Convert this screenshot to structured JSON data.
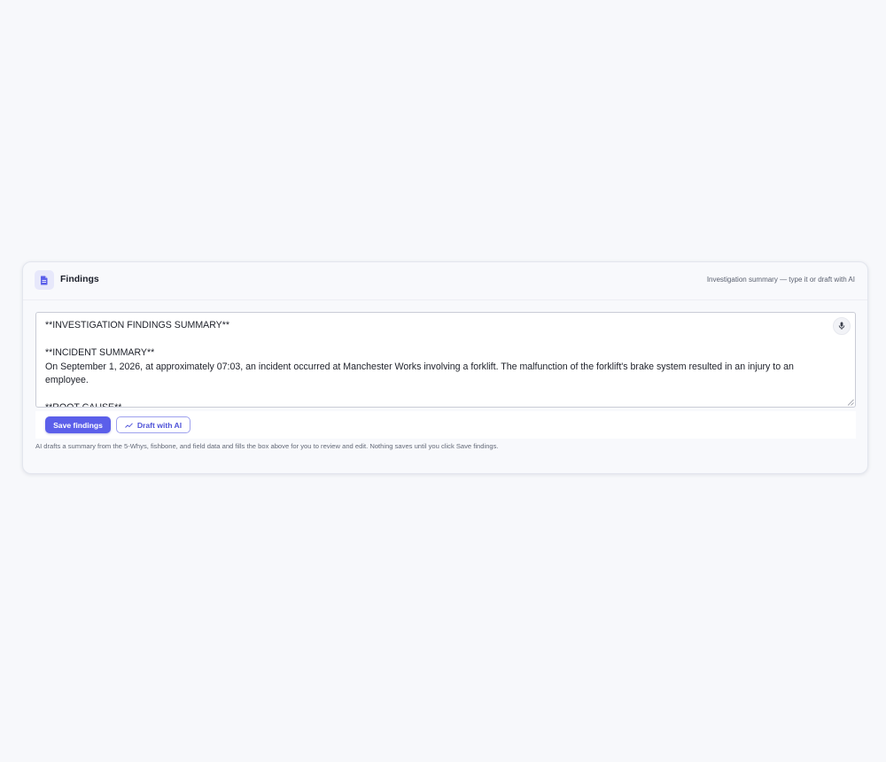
{
  "card": {
    "title": "Findings",
    "subtitle": "Investigation summary — type it or draft with AI",
    "icon": "document-icon"
  },
  "editor": {
    "value": "**INVESTIGATION FINDINGS SUMMARY**\n\n**INCIDENT SUMMARY**\nOn September 1, 2026, at approximately 07:03, an incident occurred at Manchester Works involving a forklift. The malfunction of the forklift's brake system resulted in an injury to an employee.\n\n**ROOT CAUSE**",
    "mic_icon": "microphone-icon"
  },
  "actions": {
    "save_label": "Save findings",
    "draft_label": "Draft with AI",
    "draft_icon": "trend-line-icon"
  },
  "help_text": "AI drafts a summary from the 5-Whys, fishbone, and field data and fills the box above for you to review and edit. Nothing saves until you click Save findings.",
  "colors": {
    "accent": "#5b5fea",
    "accent_light": "#e7e8fb",
    "background": "#f7f8fb"
  }
}
